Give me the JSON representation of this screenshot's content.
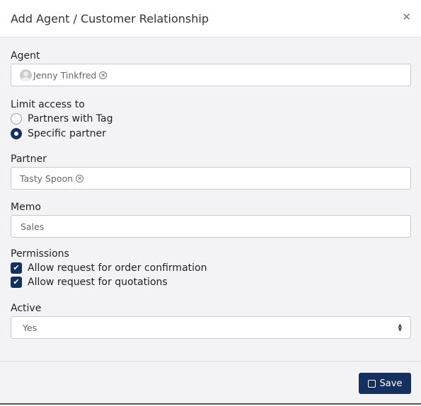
{
  "dialog": {
    "title": "Add Agent / Customer Relationship",
    "close_icon": "close-icon"
  },
  "agent": {
    "label": "Agent",
    "value": "Jenny Tinkfred"
  },
  "limit": {
    "label": "Limit access to",
    "options": [
      {
        "label": "Partners with Tag",
        "selected": false
      },
      {
        "label": "Specific partner",
        "selected": true
      }
    ]
  },
  "partner": {
    "label": "Partner",
    "value": "Tasty Spoon"
  },
  "memo": {
    "label": "Memo",
    "value": "Sales"
  },
  "permissions": {
    "label": "Permissions",
    "items": [
      {
        "label": "Allow request for order confirmation",
        "checked": true
      },
      {
        "label": "Allow request for quotations",
        "checked": true
      }
    ]
  },
  "active": {
    "label": "Active",
    "value": "Yes"
  },
  "footer": {
    "save_label": "Save"
  },
  "colors": {
    "accent": "#15305e"
  }
}
